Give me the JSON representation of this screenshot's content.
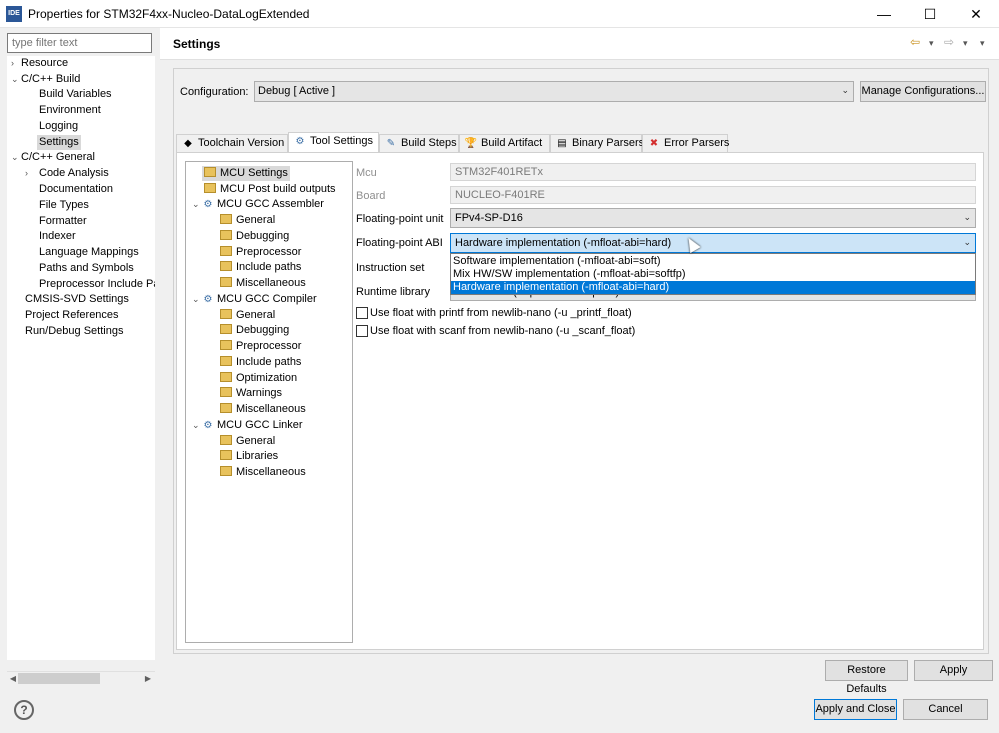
{
  "window": {
    "title": "Properties for STM32F4xx-Nucleo-DataLogExtended",
    "app_icon": "IDE",
    "minimize": "—",
    "maximize": "☐",
    "close": "✕"
  },
  "left": {
    "filter_placeholder": "type filter text",
    "items": [
      {
        "label": "Resource",
        "twisty": "›"
      },
      {
        "label": "C/C++ Build",
        "twisty": "⌄"
      },
      {
        "label": "Build Variables"
      },
      {
        "label": "Environment"
      },
      {
        "label": "Logging"
      },
      {
        "label": "Settings"
      },
      {
        "label": "C/C++ General",
        "twisty": "⌄"
      },
      {
        "label": "Code Analysis",
        "twisty": "›"
      },
      {
        "label": "Documentation"
      },
      {
        "label": "File Types"
      },
      {
        "label": "Formatter"
      },
      {
        "label": "Indexer"
      },
      {
        "label": "Language Mappings"
      },
      {
        "label": "Paths and Symbols"
      },
      {
        "label": "Preprocessor Include Pat"
      },
      {
        "label": "CMSIS-SVD Settings"
      },
      {
        "label": "Project References"
      },
      {
        "label": "Run/Debug Settings"
      }
    ]
  },
  "page": {
    "title": "Settings",
    "back_icon": "⇦",
    "forward_icon": "⇨",
    "menu_icon": "▾",
    "configuration_label": "Configuration:",
    "configuration_value": "Debug  [ Active ]",
    "manage_button": "Manage Configurations..."
  },
  "tabs": [
    {
      "label": "Toolchain  Version",
      "icon": "◆"
    },
    {
      "label": "Tool Settings",
      "icon": "⚙"
    },
    {
      "label": "Build Steps",
      "icon": "✎"
    },
    {
      "label": "Build Artifact",
      "icon": "🏆"
    },
    {
      "label": "Binary Parsers",
      "icon": "▤"
    },
    {
      "label": "Error Parsers",
      "icon": "✖"
    }
  ],
  "tree": {
    "items": [
      {
        "label": "MCU Settings"
      },
      {
        "label": "MCU Post build outputs"
      },
      {
        "label": "MCU GCC Assembler"
      },
      {
        "label": "General"
      },
      {
        "label": "Debugging"
      },
      {
        "label": "Preprocessor"
      },
      {
        "label": "Include paths"
      },
      {
        "label": "Miscellaneous"
      },
      {
        "label": "MCU GCC Compiler"
      },
      {
        "label": "General"
      },
      {
        "label": "Debugging"
      },
      {
        "label": "Preprocessor"
      },
      {
        "label": "Include paths"
      },
      {
        "label": "Optimization"
      },
      {
        "label": "Warnings"
      },
      {
        "label": "Miscellaneous"
      },
      {
        "label": "MCU GCC Linker"
      },
      {
        "label": "General"
      },
      {
        "label": "Libraries"
      },
      {
        "label": "Miscellaneous"
      }
    ]
  },
  "form": {
    "mcu_label": "Mcu",
    "mcu_value": "STM32F401RETx",
    "board_label": "Board",
    "board_value": "NUCLEO-F401RE",
    "fpu_label": "Floating-point unit",
    "fpu_value": "FPv4-SP-D16",
    "abi_label": "Floating-point ABI",
    "abi_value": "Hardware implementation (-mfloat-abi=hard)",
    "abi_options": [
      "Software implementation (-mfloat-abi=soft)",
      "Mix HW/SW implementation (-mfloat-abi=softfp)",
      "Hardware implementation (-mfloat-abi=hard)"
    ],
    "instruction_label": "Instruction set",
    "runtime_label": "Runtime library",
    "runtime_value": "Reduced C (--specs=nano.specs)",
    "printf_label": "Use float with printf from newlib-nano (-u _printf_float)",
    "scanf_label": "Use float with scanf from newlib-nano (-u _scanf_float)"
  },
  "buttons": {
    "restore": "Restore Defaults",
    "apply": "Apply",
    "apply_close": "Apply and Close",
    "cancel": "Cancel",
    "help": "?"
  }
}
